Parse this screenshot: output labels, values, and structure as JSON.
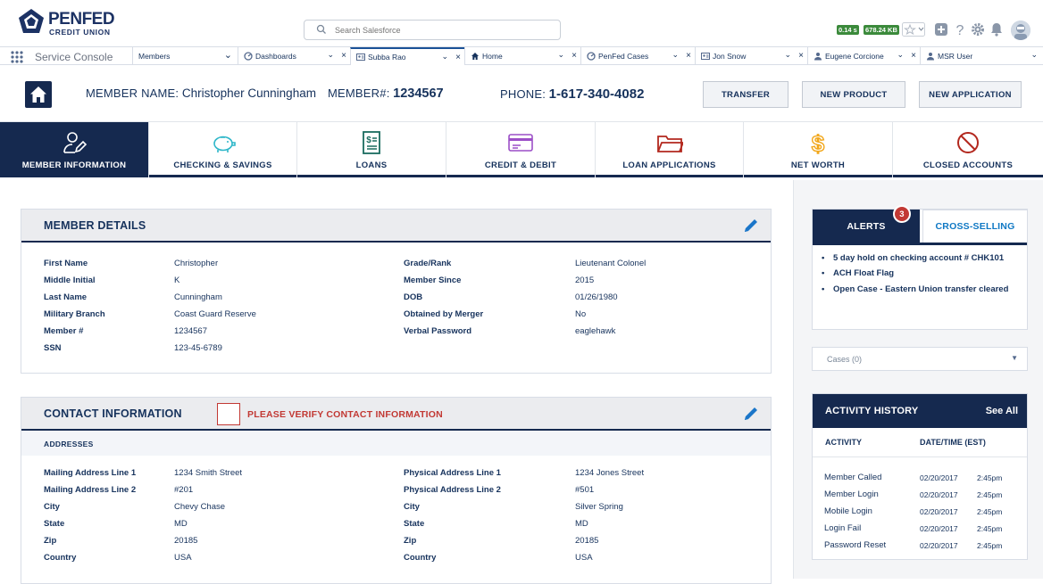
{
  "brand": {
    "name": "PENFED",
    "sub": "CREDIT UNION",
    "color": "#1c3264"
  },
  "search": {
    "placeholder": "Search Salesforce"
  },
  "perf": {
    "time": "0.14 s",
    "size": "678.24 KB"
  },
  "console": {
    "app_name": "Service Console",
    "tabs": [
      {
        "label": "Members",
        "icon": "none"
      },
      {
        "label": "Dashboards",
        "icon": "dashboard-icon"
      },
      {
        "label": "Subba Rao",
        "icon": "contact-icon"
      },
      {
        "label": "Home",
        "icon": "home-icon"
      },
      {
        "label": "PenFed Cases",
        "icon": "dashboard-icon"
      },
      {
        "label": "Jon Snow",
        "icon": "contact-icon"
      },
      {
        "label": "Eugene Corcione",
        "icon": "person-icon"
      },
      {
        "label": "MSR User",
        "icon": "person-icon"
      }
    ]
  },
  "member": {
    "name_label": "MEMBER NAME:",
    "name": "Christopher Cunningham",
    "number_label": "MEMBER#:",
    "number": "1234567",
    "phone_label": "PHONE:",
    "phone": "1-617-340-4082"
  },
  "actions": {
    "transfer": "TRANSFER",
    "new_product": "NEW PRODUCT",
    "new_application": "NEW APPLICATION"
  },
  "categories": [
    {
      "label": "MEMBER INFORMATION",
      "icon": "member-edit-icon"
    },
    {
      "label": "CHECKING & SAVINGS",
      "icon": "piggy-bank-icon"
    },
    {
      "label": "LOANS",
      "icon": "loan-document-icon"
    },
    {
      "label": "CREDIT & DEBIT",
      "icon": "credit-card-icon"
    },
    {
      "label": "LOAN APPLICATIONS",
      "icon": "folder-icon"
    },
    {
      "label": "NET WORTH",
      "icon": "dollar-icon"
    },
    {
      "label": "CLOSED ACCOUNTS",
      "icon": "closed-circle-icon"
    }
  ],
  "member_details": {
    "title": "MEMBER DETAILS",
    "left": [
      {
        "label": "First Name",
        "value": "Christopher"
      },
      {
        "label": "Middle Initial",
        "value": "K"
      },
      {
        "label": "Last Name",
        "value": "Cunningham"
      },
      {
        "label": "Military Branch",
        "value": "Coast Guard Reserve"
      },
      {
        "label": "Member #",
        "value": "1234567"
      },
      {
        "label": "SSN",
        "value": "123-45-6789"
      }
    ],
    "right": [
      {
        "label": "Grade/Rank",
        "value": "Lieutenant Colonel"
      },
      {
        "label": "Member Since",
        "value": "2015"
      },
      {
        "label": "DOB",
        "value": "01/26/1980"
      },
      {
        "label": "Obtained by Merger",
        "value": "No"
      },
      {
        "label": "Verbal Password",
        "value": "eaglehawk"
      }
    ]
  },
  "contact_info": {
    "title": "CONTACT INFORMATION",
    "verify_text": "PLEASE VERIFY CONTACT INFORMATION",
    "addresses_label": "ADDRESSES",
    "left": [
      {
        "label": "Mailing Address Line 1",
        "value": "1234 Smith Street"
      },
      {
        "label": "Mailing Address Line 2",
        "value": "#201"
      },
      {
        "label": "City",
        "value": "Chevy Chase"
      },
      {
        "label": "State",
        "value": "MD"
      },
      {
        "label": "Zip",
        "value": "20185"
      },
      {
        "label": "Country",
        "value": "USA"
      }
    ],
    "right": [
      {
        "label": "Physical Address Line 1",
        "value": "1234 Jones Street"
      },
      {
        "label": "Physical Address Line 2",
        "value": "#501"
      },
      {
        "label": "City",
        "value": "Silver Spring"
      },
      {
        "label": "State",
        "value": "MD"
      },
      {
        "label": "Zip",
        "value": "20185"
      },
      {
        "label": "Country",
        "value": "USA"
      }
    ]
  },
  "alerts": {
    "tab_alerts": "ALERTS",
    "tab_cross": "CROSS-SELLING",
    "count": "3",
    "items": [
      "5 day hold on checking account # CHK101",
      "ACH Float Flag",
      "Open Case - Eastern Union transfer cleared"
    ]
  },
  "cases": {
    "label": "Cases (0)"
  },
  "activity": {
    "title": "ACTIVITY HISTORY",
    "see_all": "See All",
    "col_activity": "ACTIVITY",
    "col_datetime": "DATE/TIME (EST)",
    "rows": [
      {
        "activity": "Member Called",
        "date": "02/20/2017",
        "time": "2:45pm"
      },
      {
        "activity": "Member Login",
        "date": "02/20/2017",
        "time": "2:45pm"
      },
      {
        "activity": "Mobile Login",
        "date": "02/20/2017",
        "time": "2:45pm"
      },
      {
        "activity": "Login Fail",
        "date": "02/20/2017",
        "time": "2:45pm"
      },
      {
        "activity": "Password Reset",
        "date": "02/20/2017",
        "time": "2:45pm"
      }
    ]
  },
  "colors": {
    "navy": "#15294f",
    "accent_blue": "#0f78c4",
    "alert_red": "#c23934",
    "perf_green": "#3b8a3b"
  }
}
